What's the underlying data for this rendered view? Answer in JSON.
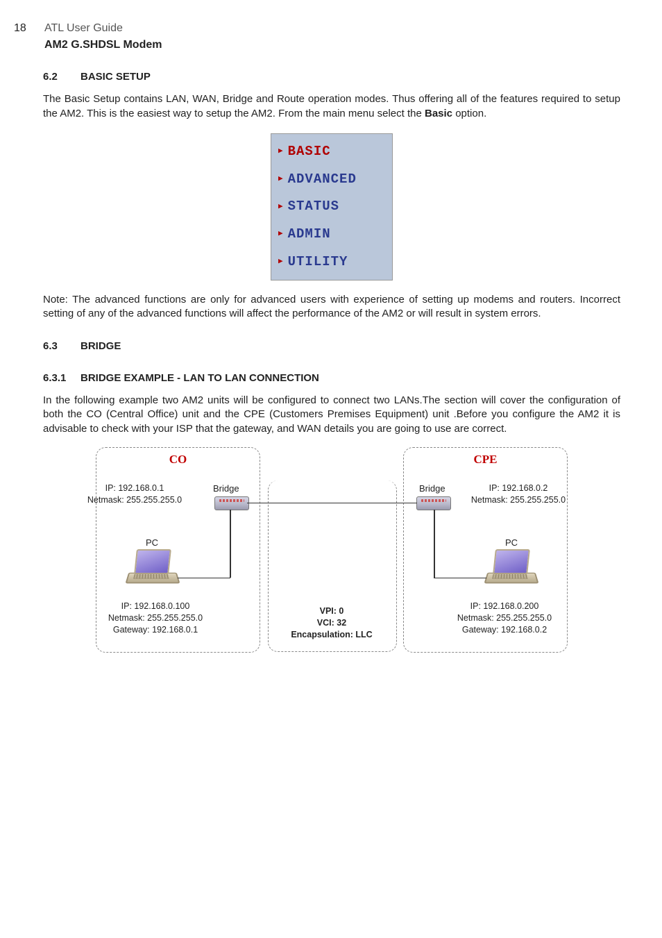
{
  "header": {
    "page_number": "18",
    "title": "ATL User Guide",
    "subtitle": "AM2 G.SHDSL Modem"
  },
  "section62": {
    "num": "6.2",
    "title": "BASIC SETUP",
    "para_a": "The Basic Setup contains LAN, WAN, Bridge and Route operation modes. Thus offering all of the features required to setup the AM2. This is the easiest way to setup the AM2. From the main menu select the ",
    "para_bold": "Basic",
    "para_b": " option.",
    "note": "Note: The advanced functions are only for advanced users with experience of setting up modems and routers. Incorrect setting of any of the advanced functions will affect the performance of the AM2 or will result in system errors."
  },
  "menu": {
    "items": [
      {
        "label": "BASIC",
        "color": "red"
      },
      {
        "label": "ADVANCED",
        "color": "blue"
      },
      {
        "label": "STATUS",
        "color": "blue"
      },
      {
        "label": "ADMIN",
        "color": "blue"
      },
      {
        "label": "UTILITY",
        "color": "blue"
      }
    ]
  },
  "section63": {
    "num": "6.3",
    "title": "BRIDGE"
  },
  "section631": {
    "num": "6.3.1",
    "title": "BRIDGE EXAMPLE - LAN TO LAN CONNECTION",
    "para": "In the following example two AM2 units will be configured to connect two LANs.The section will cover the configuration of both the CO (Central Office) unit and the CPE (Customers Premises Equipment) unit .Before you configure the AM2 it is advisable to check with your ISP that the gateway, and WAN details  you are going to use are correct."
  },
  "diagram": {
    "co": {
      "title": "CO",
      "modem_ip": "IP: 192.168.0.1",
      "modem_mask": "Netmask: 255.255.255.0",
      "bridge_label": "Bridge",
      "pc_label": "PC",
      "pc_ip": "IP: 192.168.0.100",
      "pc_mask": "Netmask: 255.255.255.0",
      "pc_gw": "Gateway: 192.168.0.1"
    },
    "cpe": {
      "title": "CPE",
      "modem_ip": "IP: 192.168.0.2",
      "modem_mask": "Netmask: 255.255.255.0",
      "bridge_label": "Bridge",
      "pc_label": "PC",
      "pc_ip": "IP: 192.168.0.200",
      "pc_mask": "Netmask: 255.255.255.0",
      "pc_gw": "Gateway: 192.168.0.2"
    },
    "link": {
      "vpi": "VPI: 0",
      "vci": "VCI: 32",
      "encap": "Encapsulation: LLC"
    }
  }
}
